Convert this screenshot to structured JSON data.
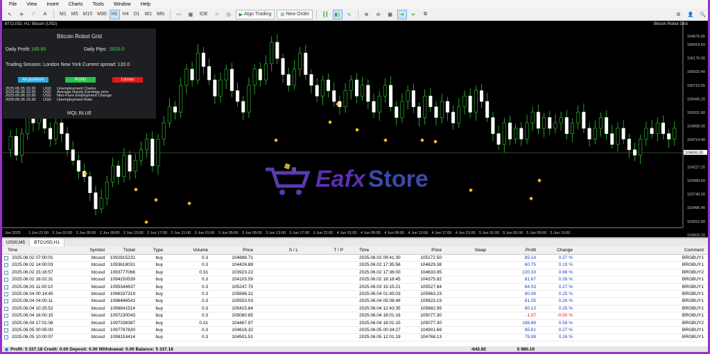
{
  "menu": [
    "File",
    "View",
    "Insert",
    "Charts",
    "Tools",
    "Window",
    "Help"
  ],
  "toolbar": {
    "timeframes": [
      "M1",
      "M5",
      "M15",
      "M30",
      "H1",
      "H4",
      "D1",
      "W1",
      "MN"
    ],
    "active_timeframe": "H1",
    "ide_label": "IDE",
    "algo_label": "Algo Trading",
    "new_order_label": "New Order"
  },
  "chart": {
    "title": "BTCUSD, H1: Bitcoin (USD)",
    "expert_name": "Bitcoin Robot Grid",
    "current_price": "104693.00",
    "price_labels": [
      "104675.65",
      "106419.60",
      "106176.00",
      "105932.40",
      "105710.55",
      "105445.20",
      "105201.60",
      "104958.00",
      "104714.40",
      "104470.80",
      "104227.20",
      "103983.60",
      "103740.00",
      "103496.40",
      "103252.80",
      "103009.20"
    ],
    "time_labels": [
      "Jun 2025",
      "1 Jun 21:00",
      "2 Jun 01:00",
      "2 Jun 05:00",
      "2 Jun 09:00",
      "2 Jun 13:00",
      "2 Jun 17:00",
      "2 Jun 21:00",
      "3 Jun 01:00",
      "3 Jun 05:00",
      "3 Jun 09:00",
      "3 Jun 13:00",
      "3 Jun 17:00",
      "3 Jun 21:00",
      "4 Jun 01:00",
      "4 Jun 05:00",
      "4 Jun 09:00",
      "4 Jun 13:00",
      "4 Jun 17:00",
      "4 Jun 21:00",
      "5 Jun 01:00",
      "5 Jun 05:00",
      "5 Jun 09:00",
      "5 Jun 13:00"
    ]
  },
  "panel": {
    "title": "Bitcoin Robot Grid",
    "daily_profit_label": "Daily Profit:",
    "daily_profit_value": "165.60",
    "daily_pips_label": "Daily Pips:",
    "daily_pips_value": "5520.0",
    "session_text": "Trading Session: London New York  Current spread: 120.0",
    "btn_all": "All positions",
    "btn_profits": "Profits",
    "btn_losses": "Losses",
    "news": [
      {
        "date": "2025.06.05 15:30",
        "cur": "USD",
        "event": "Unemployment Claims"
      },
      {
        "date": "2025.06.06 15:30",
        "cur": "USD",
        "event": "Average Hourly Earnings m/m"
      },
      {
        "date": "2025.06.06 15:30",
        "cur": "USD",
        "event": "Non-Farm Employment Change"
      },
      {
        "date": "2025.06.06 15:30",
        "cur": "USD",
        "event": "Unemployment Rate"
      }
    ],
    "footer": "MQL BLUE"
  },
  "watermark": {
    "part1": "Eafx",
    "part2": "Store"
  },
  "tabs": [
    "US30,M5",
    "BTCUSD,H1"
  ],
  "table": {
    "headers": {
      "time": "Time",
      "symbol": "Symbol",
      "ticket": "Ticket",
      "type": "Type",
      "volume": "Volume",
      "price": "Price",
      "sl": "S / L",
      "tp": "T / P",
      "time2": "Time",
      "price2": "Price",
      "swap": "Swap",
      "profit": "Profit",
      "change": "Change",
      "comment": "Comment"
    },
    "rows": [
      {
        "time": "2025.06.02 07:00:01",
        "symbol": "btcusd",
        "ticket": "1092915231",
        "type": "buy",
        "volume": "0.3",
        "price": "104888.71",
        "time2": "2025.06.02 09:41:30",
        "price2": "105172.50",
        "profit": "85.14",
        "change": "0.27 %",
        "comment": "BRGBUY1"
      },
      {
        "time": "2025.06.02 14:00:03",
        "symbol": "btcusd",
        "ticket": "1093618031",
        "type": "buy",
        "volume": "0.3",
        "price": "104426.88",
        "time2": "2025.06.02 17:35:56",
        "price2": "104629.38",
        "profit": "60.75",
        "change": "0.19 %",
        "comment": "BRGBUY1"
      },
      {
        "time": "2025.06.02 15:16:57",
        "symbol": "btcusd",
        "ticket": "1093777066",
        "type": "buy",
        "volume": "0.31",
        "price": "103923.22",
        "time2": "2025.06.02 17:36:00",
        "price2": "104633.95",
        "profit": "220.33",
        "change": "0.68 %",
        "comment": "BRGBUY2"
      },
      {
        "time": "2025.06.02 18:02:31",
        "symbol": "btcusd",
        "ticket": "1094150539",
        "type": "buy",
        "volume": "0.3",
        "price": "104103.59",
        "time2": "2025.06.02 18:18:45",
        "price2": "104375.82",
        "profit": "81.67",
        "change": "0.26 %",
        "comment": "BRGBUY1"
      },
      {
        "time": "2025.06.03 11:00:10",
        "symbol": "btcusd",
        "ticket": "1095344637",
        "type": "buy",
        "volume": "0.3",
        "price": "105247.75",
        "time2": "2025.06.03 15:15:21",
        "price2": "105527.84",
        "profit": "84.03",
        "change": "0.27 %",
        "comment": "BRGBUY1"
      },
      {
        "time": "2025.06.04 00:14:45",
        "symbol": "btcusd",
        "ticket": "1096337319",
        "type": "buy",
        "volume": "0.3",
        "price": "105696.31",
        "time2": "2025.06.04 01:45:03",
        "price2": "105963.23",
        "profit": "80.08",
        "change": "0.25 %",
        "comment": "BRGBUY1"
      },
      {
        "time": "2025.06.04 04:00:11",
        "symbol": "btcusd",
        "ticket": "1096486541",
        "type": "buy",
        "volume": "0.3",
        "price": "105553.03",
        "time2": "2025.06.04 05:08:48",
        "price2": "105823.19",
        "profit": "81.05",
        "change": "0.26 %",
        "comment": "BRGBUY1"
      },
      {
        "time": "2025.06.04 10:25:52",
        "symbol": "btcusd",
        "ticket": "1096841514",
        "type": "buy",
        "volume": "0.3",
        "price": "105415.84",
        "time2": "2025.06.04 12:43:35",
        "price2": "105682.95",
        "profit": "80.13",
        "change": "0.25 %",
        "comment": "BRGBUY1"
      },
      {
        "time": "2025.06.04 16:00:15",
        "symbol": "btcusd",
        "ticket": "1097230043",
        "type": "buy",
        "volume": "0.3",
        "price": "105080.85",
        "time2": "2025.06.04 18:01:16",
        "price2": "105077.30",
        "profit": "-1.07",
        "change": "-0.00 %",
        "comment": "BRGBUY1",
        "neg": true
      },
      {
        "time": "2025.06.04 17:01:08",
        "symbol": "btcusd",
        "ticket": "1097338387",
        "type": "buy",
        "volume": "0.31",
        "price": "104467.97",
        "time2": "2025.06.04 18:01:15",
        "price2": "105077.30",
        "profit": "188.89",
        "change": "0.58 %",
        "comment": "BRGBUY2"
      },
      {
        "time": "2025.06.05 00:05:00",
        "symbol": "btcusd",
        "ticket": "1097797830",
        "type": "buy",
        "volume": "0.3",
        "price": "104616.32",
        "time2": "2025.06.05 00:34:27",
        "price2": "104901.69",
        "profit": "85.61",
        "change": "0.27 %",
        "comment": "BRGBUY1"
      },
      {
        "time": "2025.06.05 10:00:07",
        "symbol": "btcusd",
        "ticket": "1098153414",
        "type": "buy",
        "volume": "0.3",
        "price": "104501.51",
        "time2": "2025.06.05 12:01:19",
        "price2": "104768.13",
        "profit": "79.99",
        "change": "0.26 %",
        "comment": "BRGBUY1"
      }
    ]
  },
  "status": {
    "summary": "Profit: 5 337.18  Credit: 0.00  Deposit: 0.00  Withdrawal: 0.00  Balance: 5 337.18",
    "swap_total": "-642.92",
    "profit_total": "5 980.10"
  }
}
